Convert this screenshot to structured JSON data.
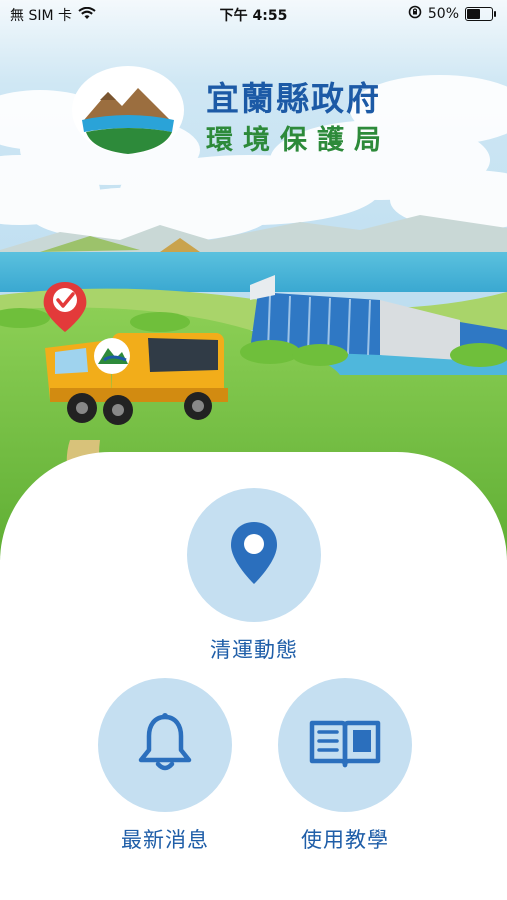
{
  "status_bar": {
    "carrier": "無 SIM 卡",
    "time": "下午 4:55",
    "battery_percent": "50%",
    "battery_level": 0.5
  },
  "header": {
    "title": "宜蘭縣政府",
    "subtitle": "環境保護局"
  },
  "menu": {
    "items": [
      {
        "label": "清運動態",
        "icon": "location-pin-icon"
      },
      {
        "label": "最新消息",
        "icon": "bell-icon"
      },
      {
        "label": "使用教學",
        "icon": "book-icon"
      }
    ]
  },
  "colors": {
    "brand_blue": "#1c5aa6",
    "brand_green": "#2d8a3a",
    "button_circle": "#c5dff1",
    "sky": "#b9dbef"
  }
}
